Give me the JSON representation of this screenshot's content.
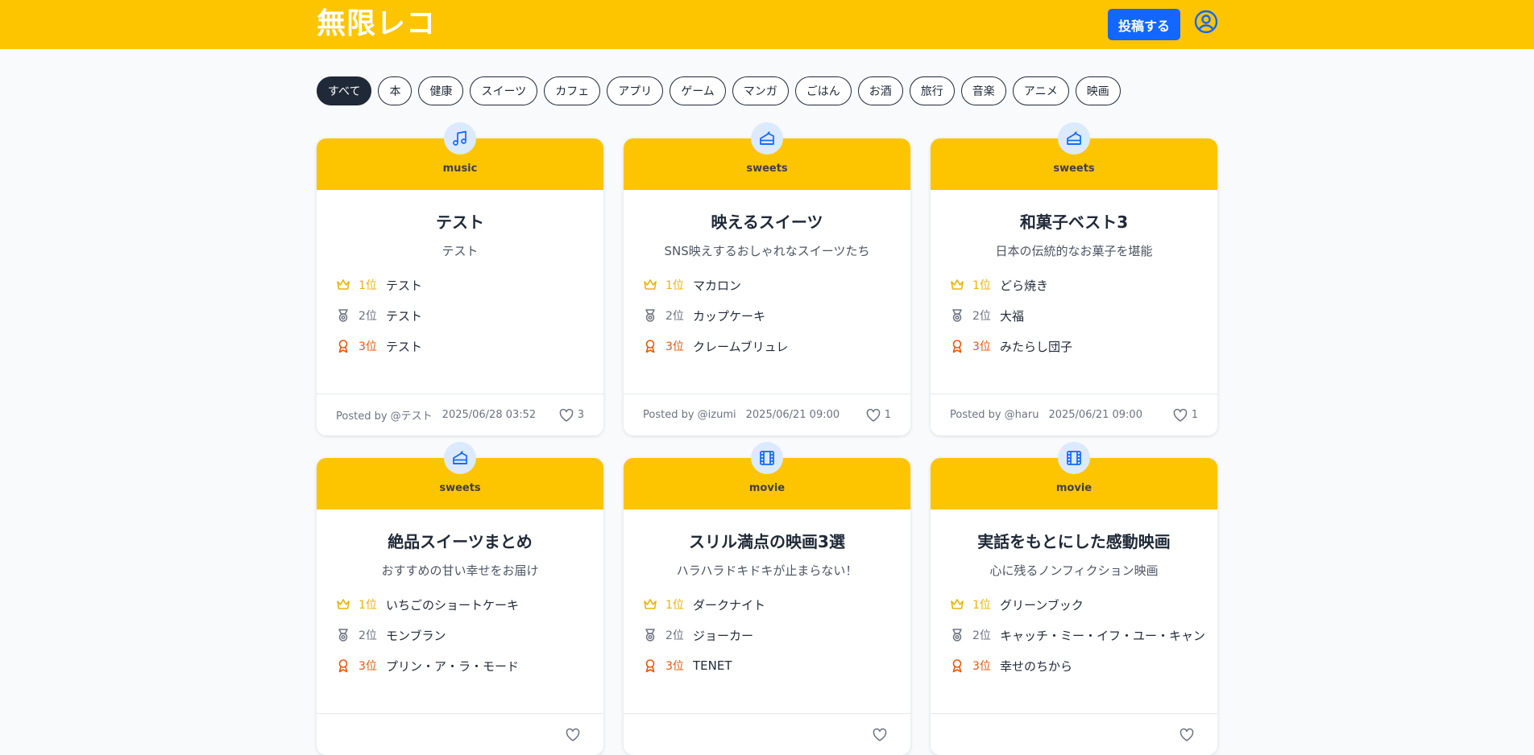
{
  "header": {
    "logo": "無限レコ",
    "post_button": "投稿する"
  },
  "filters": [
    "すべて",
    "本",
    "健康",
    "スイーツ",
    "カフェ",
    "アプリ",
    "ゲーム",
    "マンガ",
    "ごはん",
    "お酒",
    "旅行",
    "音楽",
    "アニメ",
    "映画"
  ],
  "rank_labels": [
    "1位",
    "2位",
    "3位"
  ],
  "cards": [
    {
      "category": "music",
      "icon": "music-icon",
      "title": "テスト",
      "description": "テスト",
      "ranks": [
        "テスト",
        "テスト",
        "テスト"
      ],
      "posted_by": "Posted by @テスト",
      "date": "2025/06/28 03:52",
      "likes": "3"
    },
    {
      "category": "sweets",
      "icon": "cake-icon",
      "title": "映えるスイーツ",
      "description": "SNS映えするおしゃれなスイーツたち",
      "ranks": [
        "マカロン",
        "カップケーキ",
        "クレームブリュレ"
      ],
      "posted_by": "Posted by @izumi",
      "date": "2025/06/21 09:00",
      "likes": "1"
    },
    {
      "category": "sweets",
      "icon": "cake-icon",
      "title": "和菓子ベスト3",
      "description": "日本の伝統的なお菓子を堪能",
      "ranks": [
        "どら焼き",
        "大福",
        "みたらし団子"
      ],
      "posted_by": "Posted by @haru",
      "date": "2025/06/21 09:00",
      "likes": "1"
    },
    {
      "category": "sweets",
      "icon": "cake-icon",
      "title": "絶品スイーツまとめ",
      "description": "おすすめの甘い幸せをお届け",
      "ranks": [
        "いちごのショートケーキ",
        "モンブラン",
        "プリン・ア・ラ・モード"
      ],
      "posted_by": "",
      "date": "",
      "likes": ""
    },
    {
      "category": "movie",
      "icon": "film-icon",
      "title": "スリル満点の映画3選",
      "description": "ハラハラドキドキが止まらない！",
      "ranks": [
        "ダークナイト",
        "ジョーカー",
        "TENET"
      ],
      "posted_by": "",
      "date": "",
      "likes": ""
    },
    {
      "category": "movie",
      "icon": "film-icon",
      "title": "実話をもとにした感動映画",
      "description": "心に残るノンフィクション映画",
      "ranks": [
        "グリーンブック",
        "キャッチ・ミー・イフ・ユー・キャン",
        "幸せのちから"
      ],
      "posted_by": "",
      "date": "",
      "likes": ""
    }
  ],
  "colors": {
    "header": "#fcc500",
    "primary": "#1167ff",
    "dark": "#1f2937",
    "gold": "#eab308",
    "silver": "#6b7280",
    "bronze": "#ea580c"
  }
}
